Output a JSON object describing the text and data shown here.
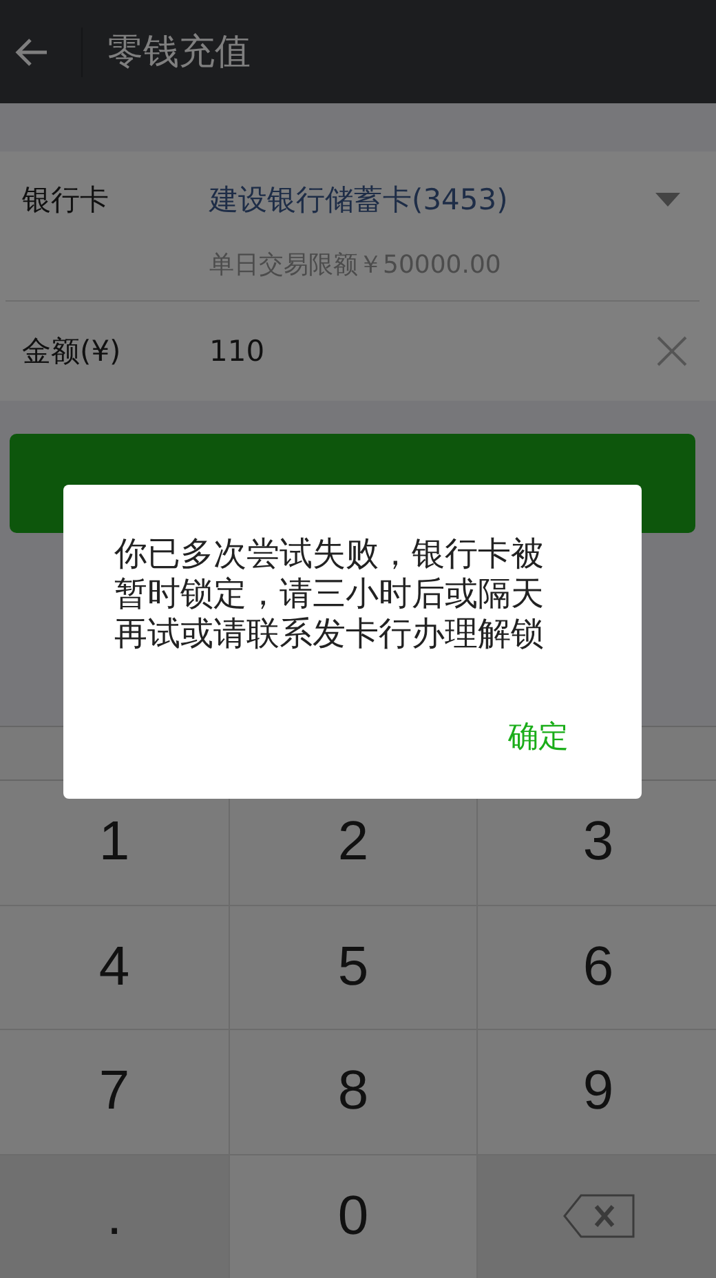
{
  "header": {
    "title": "零钱充值"
  },
  "form": {
    "bank_label": "银行卡",
    "bank_value": "建设银行储蓄卡(3453)",
    "limit": "单日交易限额￥50000.00",
    "amount_label": "金额(¥)",
    "amount_value": "110"
  },
  "next_button": {
    "kind": "primary"
  },
  "dialog": {
    "message": "你已多次尝试失败，银行卡被暂时锁定，请三小时后或隔天再试或请联系发卡行办理解锁",
    "confirm": "确定"
  },
  "keypad": [
    {
      "kind": "digit",
      "label": "1"
    },
    {
      "kind": "digit",
      "label": "2"
    },
    {
      "kind": "digit",
      "label": "3"
    },
    {
      "kind": "digit",
      "label": "4"
    },
    {
      "kind": "digit",
      "label": "5"
    },
    {
      "kind": "digit",
      "label": "6"
    },
    {
      "kind": "digit",
      "label": "7"
    },
    {
      "kind": "digit",
      "label": "8"
    },
    {
      "kind": "digit",
      "label": "9"
    },
    {
      "kind": "function",
      "label": "."
    },
    {
      "kind": "digit",
      "label": "0"
    },
    {
      "kind": "backspace"
    }
  ]
}
